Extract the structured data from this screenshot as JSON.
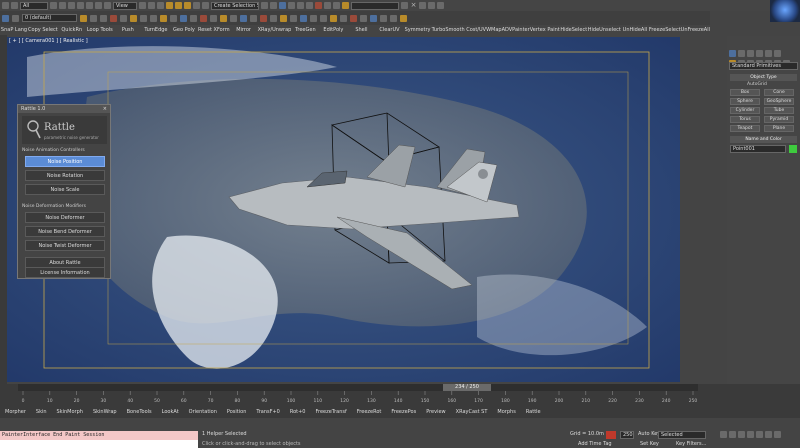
{
  "toolbar": {
    "selection_filter": "All",
    "view_mode": "View",
    "named_selection": "Create Selection Se",
    "layer": "0 (default)"
  },
  "quick_toolbar": [
    "Unlink",
    "Pivot",
    "FileMerge",
    "Mirror",
    "Array",
    "Anim",
    "Clone",
    "Align",
    "Rename",
    "Ground",
    "Orient",
    "Scale",
    "Select"
  ],
  "command_bar": [
    "SnaP Lang",
    "Copy Select",
    "QuickRn",
    "Loop Tools",
    "Push",
    "TurnEdge",
    "Geo Poly",
    "Reset XForm",
    "Mirror",
    "XRay/Unwrap",
    "TreeGen",
    "EditPoly",
    "Shell",
    "ClearUV",
    "Symmetry",
    "TurboSmooth Cost/UVWMap",
    "ADVPainter",
    "Vertex Paint",
    "HideSelect",
    "HideUnselect",
    "UnHideAll",
    "FreezeSelect",
    "UnFreezeAll"
  ],
  "viewport": {
    "label": "[ + ] [ Camera001 ] [ Realistic ]"
  },
  "rattle": {
    "title": "Rattle 1.0",
    "logo_text": "Rattle",
    "logo_sub": "parametric noise generator",
    "section_animation": "Noise Animation Controllers",
    "btn_position": "Noise Position",
    "btn_rotation": "Noise Rotation",
    "btn_scale": "Noise Scale",
    "section_deformation": "Noise Deformation Modifiers",
    "btn_deformer": "Noise Deformer",
    "btn_bend": "Noise Bend Deformer",
    "btn_twist": "Noise Twist Deformer",
    "btn_about": "About Rattle",
    "btn_license": "License Information"
  },
  "command_panel": {
    "dropdown": "Standard Primitives",
    "object_type_title": "Object Type",
    "autogrid": "AutoGrid",
    "buttons": [
      "Box",
      "Cone",
      "Sphere",
      "GeoSphere",
      "Cylinder",
      "Tube",
      "Torus",
      "Pyramid",
      "Teapot",
      "Plane"
    ],
    "name_color_title": "Name and Color",
    "object_name": "Point001",
    "swatch_color": "#3ecb3e"
  },
  "timeline": {
    "frame_display": "234 / 250",
    "ticks": [
      "0",
      "10",
      "20",
      "30",
      "40",
      "50",
      "60",
      "70",
      "80",
      "90",
      "100",
      "110",
      "120",
      "130",
      "140",
      "150",
      "160",
      "170",
      "180",
      "190",
      "200",
      "210",
      "220",
      "230",
      "240",
      "250"
    ]
  },
  "modifiers_bar": [
    "Morpher",
    "Skin",
    "SkinMorph",
    "SkinWrap",
    "BoneTools",
    "LookAt",
    "Orientation",
    "Position",
    "TransF+0",
    "Rot+0",
    "FreezeTransf",
    "FreezeRot",
    "FreezePos",
    "Preview",
    "XRayCast ST",
    "Morphs",
    "Rattle"
  ],
  "status": {
    "script_listener": "PainterInterface End Paint Session",
    "selection_text": "1 Helper Selected",
    "prompt_text": "Click or click-and-drag to select objects",
    "grid": "Grid = 10.0m",
    "add_time_tag": "Add Time Tag",
    "auto_key": "Auto Key",
    "selected": "Selected",
    "set_key": "Set Key",
    "key_filters": "Key Filters...",
    "frame_field": "250",
    "welcome_label": "Welcome to M"
  },
  "colors": {
    "accent_blue": "#5b8cd6",
    "active_red": "#c0392b",
    "swatch_green": "#3ecb3e"
  }
}
